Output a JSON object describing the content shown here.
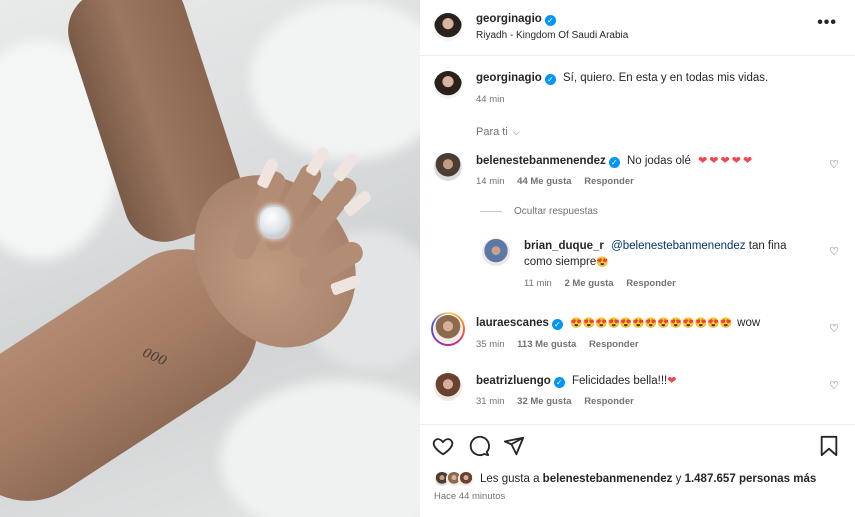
{
  "post": {
    "author": "georginagio",
    "location": "Riyadh - Kingdom Of Saudi Arabia",
    "more_icon": "more-horizontal-icon"
  },
  "caption": {
    "user": "georginagio",
    "text": "Sí, quiero. En esta y en todas mis vidas.",
    "time": "44 min"
  },
  "for_you_label": "Para ti",
  "comments": [
    {
      "user": "belenestebanmenendez",
      "text": "No jodas olé",
      "emojis": "❤❤❤❤❤",
      "time": "14 min",
      "likes": "44 Me gusta",
      "reply": "Responder"
    },
    {
      "user": "lauraescanes",
      "emojis": "😍😍😍😍😍😍😍😍😍😍😍😍😍",
      "text": "wow",
      "time": "35 min",
      "likes": "113 Me gusta",
      "reply": "Responder"
    },
    {
      "user": "beatrizluengo",
      "text": "Felicidades bella!!!",
      "emojis": "❤",
      "time": "31 min",
      "likes": "32 Me gusta",
      "reply": "Responder"
    }
  ],
  "hide_replies": "Ocultar respuestas",
  "reply_item": {
    "user": "brian_duque_r",
    "mention": "@belenestebanmenendez",
    "text_line1": "tan fina",
    "text_line2": "como siempre",
    "emoji": "😍",
    "time": "11 min",
    "likes": "2 Me gusta",
    "reply": "Responder"
  },
  "likes_summary": {
    "prefix": "Les gusta a",
    "user": "belenestebanmenendez",
    "middle": "y",
    "count": "1.487.657",
    "suffix": "personas más"
  },
  "time_ago": "Hace 44 minutos",
  "photo": {
    "tattoo_text": "000"
  },
  "icons": {
    "like": "heart-outline-icon",
    "comment": "comment-icon",
    "share": "send-icon",
    "save": "bookmark-icon"
  },
  "colors": {
    "verified": "#0095f6",
    "link": "#00376b",
    "meta": "#737373",
    "heart": "#ed4956"
  }
}
